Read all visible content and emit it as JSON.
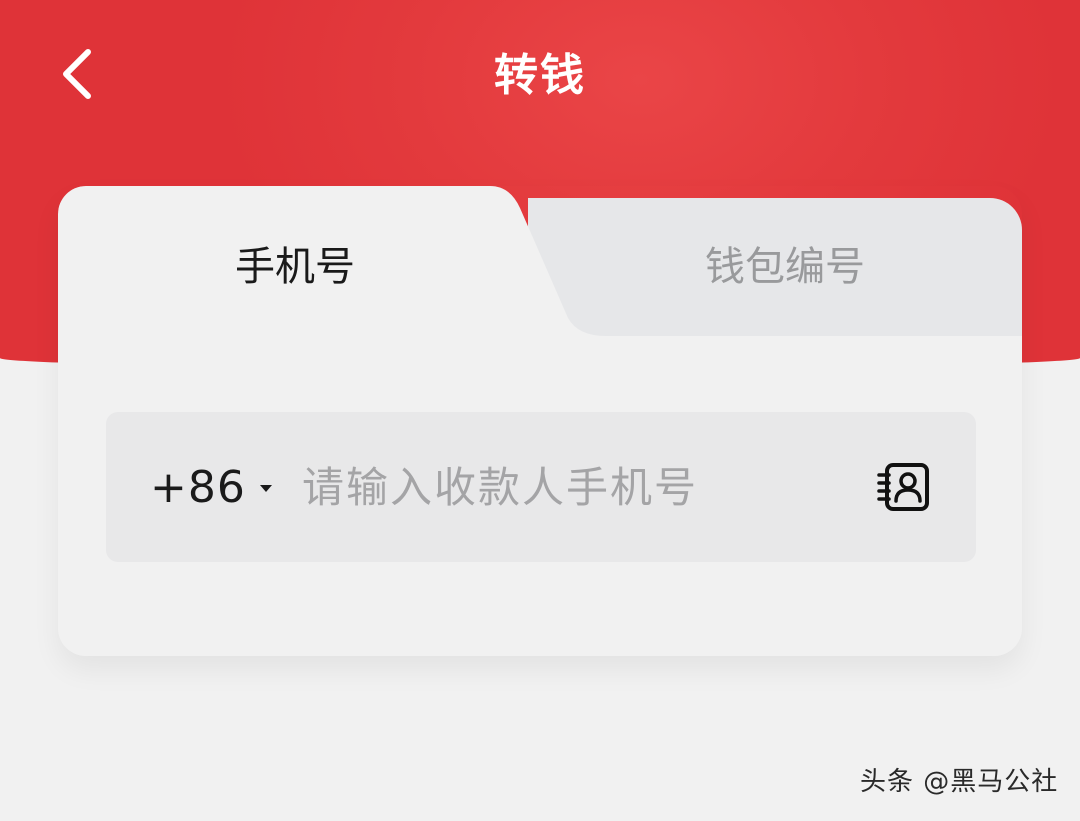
{
  "header": {
    "title": "转钱",
    "back_icon": "chevron-left-icon"
  },
  "tabs": [
    {
      "label": "手机号",
      "active": true
    },
    {
      "label": "钱包编号",
      "active": false
    }
  ],
  "phone_input": {
    "country_code": "+86",
    "value": "",
    "placeholder": "请输入收款人手机号",
    "contact_icon": "contact-book-icon"
  },
  "watermark": "头条 @黑马公社",
  "colors": {
    "header_red": "#e33a3d",
    "background": "#f1f1f1",
    "input_bg": "#e8e8e9",
    "active_text": "#1a1a1a",
    "inactive_text": "#999a9c",
    "placeholder": "#a4a4a6"
  }
}
